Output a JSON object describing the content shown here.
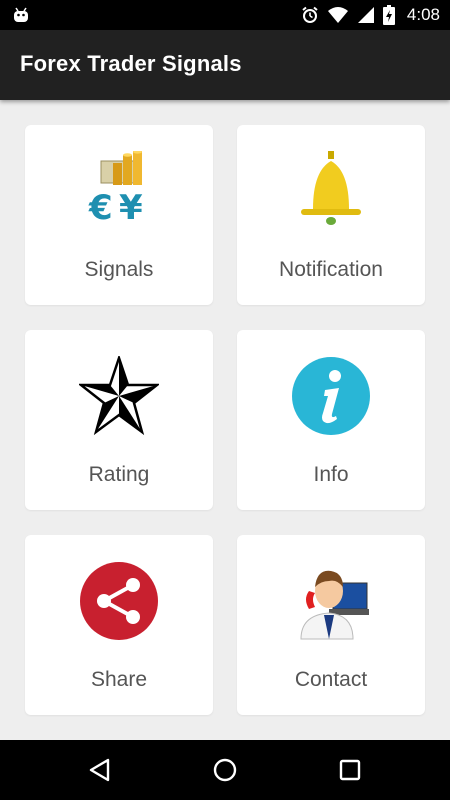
{
  "status": {
    "time": "4:08"
  },
  "app": {
    "title": "Forex Trader Signals"
  },
  "tiles": [
    {
      "label": "Signals",
      "icon": "currency-coins-icon"
    },
    {
      "label": "Notification",
      "icon": "bell-icon"
    },
    {
      "label": "Rating",
      "icon": "star-icon"
    },
    {
      "label": "Info",
      "icon": "info-icon"
    },
    {
      "label": "Share",
      "icon": "share-icon"
    },
    {
      "label": "Contact",
      "icon": "contact-person-icon"
    }
  ],
  "colors": {
    "appbar": "#212121",
    "bell": "#f1cc1f",
    "info": "#29b6d6",
    "share": "#c8202f"
  }
}
